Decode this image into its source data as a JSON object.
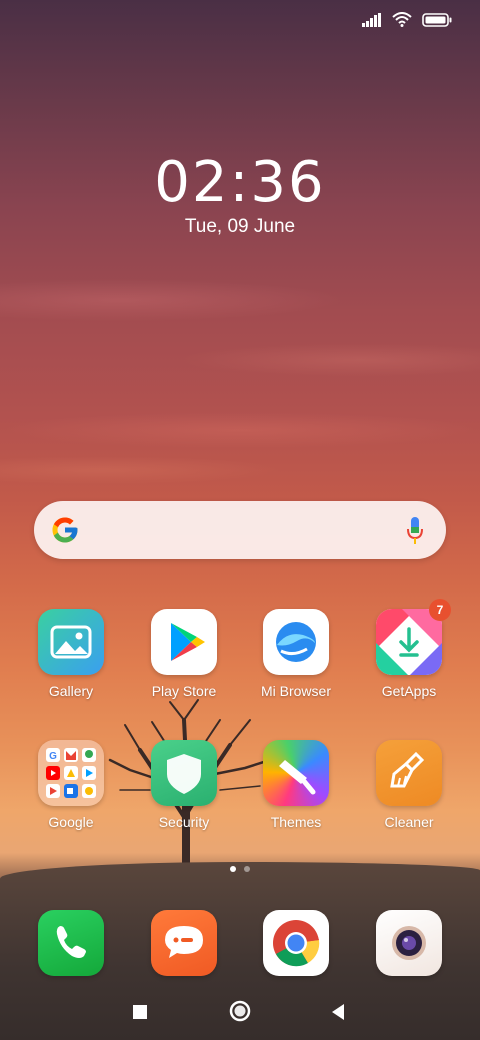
{
  "status_bar": {
    "signal_icon": "signal-icon",
    "wifi_icon": "wifi-icon",
    "battery_icon": "battery-icon"
  },
  "clock": {
    "time": "02:36",
    "date": "Tue, 09 June"
  },
  "search_bar": {
    "google_icon": "google-g-icon",
    "mic_icon": "mic-icon"
  },
  "apps": [
    {
      "label": "Gallery",
      "icon": "gallery-icon"
    },
    {
      "label": "Play Store",
      "icon": "play-store-icon"
    },
    {
      "label": "Mi Browser",
      "icon": "mi-browser-icon"
    },
    {
      "label": "GetApps",
      "icon": "getapps-icon",
      "badge": "7"
    },
    {
      "label": "Google",
      "icon": "google-folder-icon"
    },
    {
      "label": "Security",
      "icon": "security-shield-icon"
    },
    {
      "label": "Themes",
      "icon": "themes-brush-icon"
    },
    {
      "label": "Cleaner",
      "icon": "cleaner-brush-icon"
    }
  ],
  "page_indicator": {
    "pages": 2,
    "active": 1
  },
  "dock": [
    {
      "name": "phone",
      "icon": "phone-icon"
    },
    {
      "name": "messaging",
      "icon": "messaging-icon"
    },
    {
      "name": "chrome",
      "icon": "chrome-icon"
    },
    {
      "name": "camera",
      "icon": "camera-icon"
    }
  ],
  "nav": {
    "recents": "recents-square-icon",
    "home": "home-circle-icon",
    "back": "back-triangle-icon"
  },
  "colors": {
    "badge": "#e8502f",
    "phone": "#1fbf4a",
    "messaging": "#f46a2e",
    "getapps_accent": "#ff4a6a"
  }
}
